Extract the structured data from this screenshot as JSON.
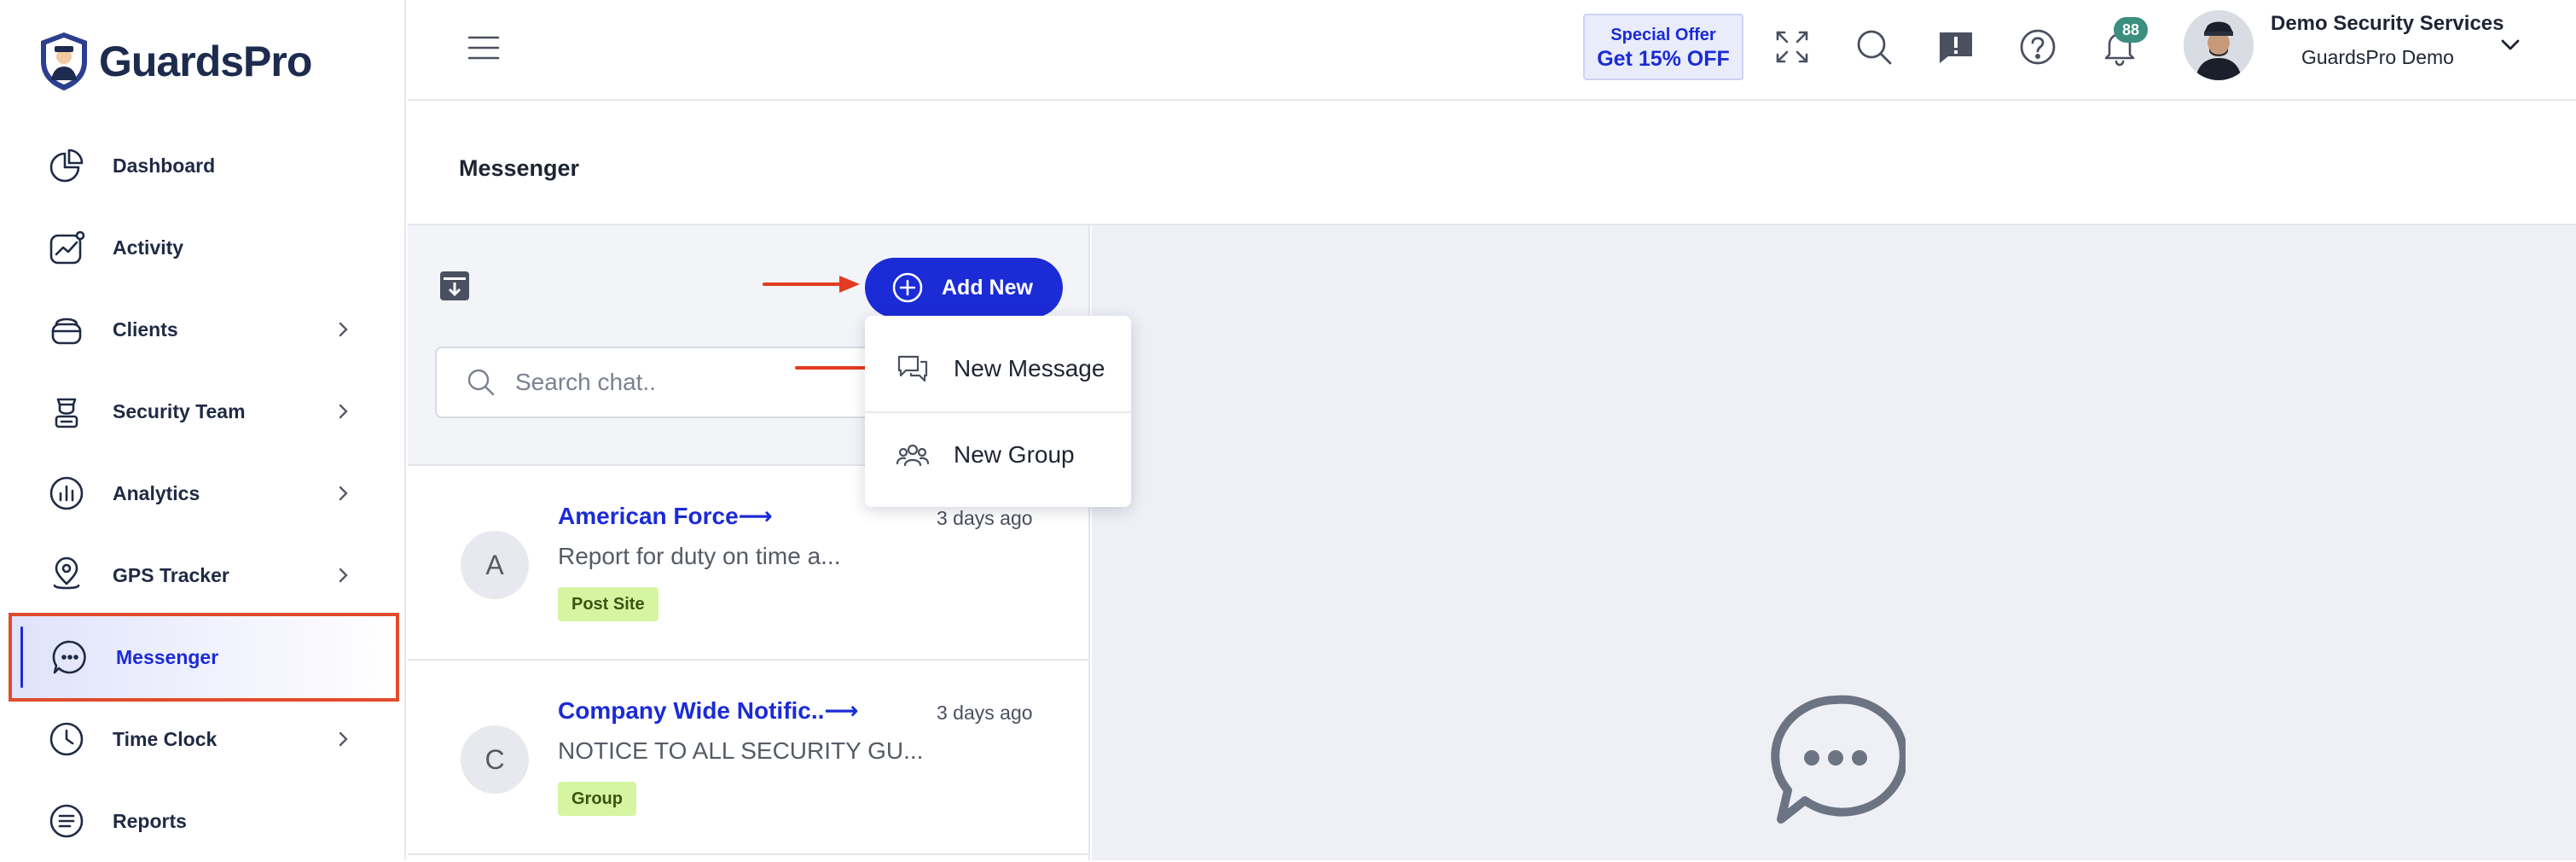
{
  "app": {
    "name": "GuardsPro",
    "accent": "#1b2bd6",
    "highlight_border": "#e04b2b",
    "arrow_color": "#e23b1f"
  },
  "sidebar": {
    "items": [
      {
        "label": "Dashboard",
        "icon": "pie-chart-icon",
        "has_chevron": false
      },
      {
        "label": "Activity",
        "icon": "activity-icon",
        "has_chevron": false
      },
      {
        "label": "Clients",
        "icon": "clients-icon",
        "has_chevron": true
      },
      {
        "label": "Security Team",
        "icon": "guard-icon",
        "has_chevron": true
      },
      {
        "label": "Analytics",
        "icon": "analytics-icon",
        "has_chevron": true
      },
      {
        "label": "GPS Tracker",
        "icon": "map-pin-icon",
        "has_chevron": true
      },
      {
        "label": "Messenger",
        "icon": "chat-icon",
        "has_chevron": false,
        "active": true
      },
      {
        "label": "Time Clock",
        "icon": "clock-icon",
        "has_chevron": true
      },
      {
        "label": "Reports",
        "icon": "reports-icon",
        "has_chevron": false
      }
    ]
  },
  "header": {
    "offer_top": "Special Offer",
    "offer_bottom": "Get 15% OFF",
    "notification_count": "88",
    "user_company": "Demo Security Services",
    "user_name": "GuardsPro Demo"
  },
  "page": {
    "title": "Messenger"
  },
  "chat_panel": {
    "add_new_label": "Add New",
    "search_placeholder": "Search chat..",
    "chats": [
      {
        "initial": "A",
        "name": "American Force⟶",
        "time": "3 days ago",
        "preview": "Report for duty on time a...",
        "tag": "Post Site"
      },
      {
        "initial": "C",
        "name": "Company Wide Notific..⟶",
        "time": "3 days ago",
        "preview": "NOTICE TO ALL SECURITY GU...",
        "tag": "Group"
      }
    ]
  },
  "dropdown": {
    "items": [
      {
        "label": "New Message",
        "icon": "new-message-icon"
      },
      {
        "label": "New Group",
        "icon": "group-icon"
      }
    ]
  },
  "conversation": {
    "empty_icon": "chat-bubble-icon"
  }
}
